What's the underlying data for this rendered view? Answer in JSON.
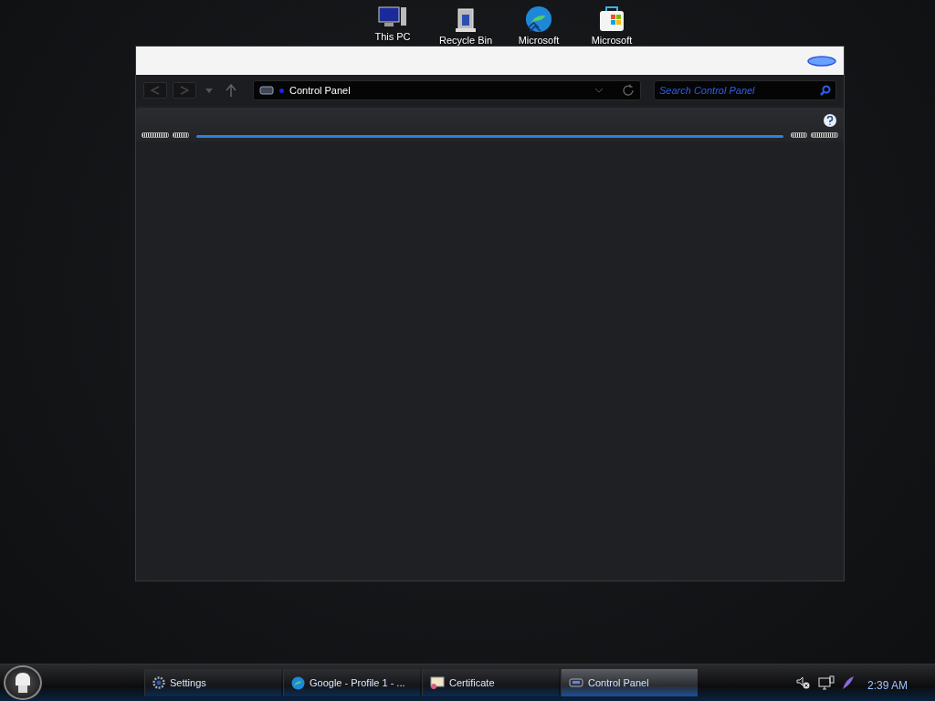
{
  "desktop_icons": [
    {
      "kind": "computer",
      "label": "This PC"
    },
    {
      "kind": "bin",
      "label": "Recycle Bin"
    },
    {
      "kind": "browser",
      "label": "Microsoft"
    },
    {
      "kind": "store",
      "label": "Microsoft"
    }
  ],
  "window": {
    "address": {
      "path": "Control Panel"
    },
    "search": {
      "placeholder": "Search Control Panel"
    }
  },
  "taskbar": {
    "items": [
      {
        "kind": "settings",
        "label": "Settings",
        "selected": false
      },
      {
        "kind": "browser",
        "label": "Google - Profile 1 - ...",
        "selected": false
      },
      {
        "kind": "certificate",
        "label": "Certificate",
        "selected": false
      },
      {
        "kind": "control-panel",
        "label": "Control Panel",
        "selected": true
      }
    ],
    "clock": "2:39 AM"
  }
}
